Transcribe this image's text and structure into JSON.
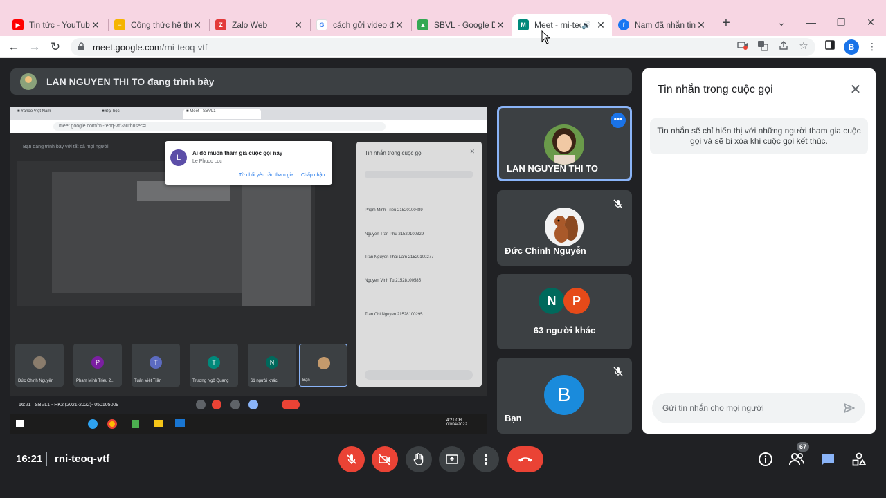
{
  "browser": {
    "tabs": [
      {
        "title": "Tin tức - YouTube",
        "fav_color": "#ff0000",
        "fav_glyph": "▶"
      },
      {
        "title": "Công thức hệ thức",
        "fav_color": "#f5b400",
        "fav_glyph": "≡"
      },
      {
        "title": "Zalo Web",
        "fav_color": "#e33a3a",
        "fav_glyph": "Z"
      },
      {
        "title": "cách gửi video đi",
        "fav_color": "#4285f4",
        "fav_glyph": "G"
      },
      {
        "title": "SBVL - Google Drive",
        "fav_color": "#34a853",
        "fav_glyph": "▲"
      },
      {
        "title": "Meet - rni-teoq",
        "fav_color": "#00897b",
        "fav_glyph": "M"
      },
      {
        "title": "Nam đã nhắn tin",
        "fav_color": "#1877f2",
        "fav_glyph": "f"
      }
    ],
    "url_host": "meet.google.com",
    "url_path": "/rni-teoq-vtf",
    "profile_initial": "B"
  },
  "presenter": {
    "label": "LAN NGUYEN THI TO đang trình bày"
  },
  "shared_screen": {
    "url": "meet.google.com/rni-teoq-vtf?authuser=0",
    "notice": "Bạn đang trình bày với tất cả mọi người",
    "dialog": {
      "initial": "L",
      "title": "Ai đó muốn tham gia cuộc gọi này",
      "name": "Le Phuoc Loc",
      "deny": "Từ chối yêu cầu tham gia",
      "accept": "Chấp nhận"
    },
    "chat_title": "Tin nhắn trong cuộc gọi",
    "chat_lines": [
      "Phạm Minh Triều 21520100489",
      "Nguyen Tran Phu 21520100329",
      "Tran Nguyen Thai Lam 21520100277",
      "Nguyen Vinh Tu 21528100585",
      "Tran Chi Nguyen 21528100295"
    ],
    "tiles": [
      {
        "name": "Đức Chinh Nguyễn",
        "initial": "",
        "color": "#8a7c6c"
      },
      {
        "name": "Pham Minh Trieu 2...",
        "initial": "P",
        "color": "#7b1fa2"
      },
      {
        "name": "Tuấn Việt Trần",
        "initial": "T",
        "color": "#5c6bc0"
      },
      {
        "name": "Trương Ngô Quang",
        "initial": "T",
        "color": "#00897b"
      },
      {
        "name": "61 người khác",
        "initial": "N",
        "color": "#00695c"
      },
      {
        "name": "Bạn",
        "initial": "",
        "color": "#c49a6c"
      }
    ],
    "bottom_text": "16:21 | SBVL1 - HK2 (2021-2022)- 050105009"
  },
  "participants": {
    "lan": {
      "name": "LAN NGUYEN THI TO"
    },
    "duc": {
      "name": "Đức Chinh Nguyễn"
    },
    "others": {
      "initials": [
        "N",
        "P"
      ],
      "label": "63 người khác"
    },
    "you": {
      "initial": "B",
      "name": "Bạn"
    }
  },
  "chat": {
    "title": "Tin nhắn trong cuộc gọi",
    "note": "Tin nhắn sẽ chỉ hiển thị với những người tham gia cuộc gọi và sẽ bị xóa khi cuộc gọi kết thúc.",
    "placeholder": "Gửi tin nhắn cho mọi người"
  },
  "bottom": {
    "time": "16:21",
    "meeting_code": "rni-teoq-vtf",
    "people_count": "67"
  },
  "colors": {
    "accent": "#1a73e8",
    "danger": "#ea4335",
    "tile_bg": "#3c4043",
    "tab_strip": "#f7d6e3"
  }
}
